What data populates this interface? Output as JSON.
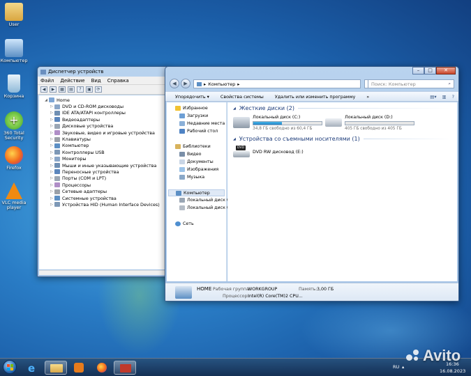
{
  "desktop": {
    "icons": [
      {
        "label": "User"
      },
      {
        "label": "Компьютер"
      },
      {
        "label": "Корзина"
      },
      {
        "label": "360 Total Security"
      },
      {
        "label": "Firefox"
      },
      {
        "label": "VLC media player"
      }
    ]
  },
  "devmgr": {
    "title": "Диспетчер устройств",
    "menu": [
      "Файл",
      "Действие",
      "Вид",
      "Справка"
    ],
    "root": "Home",
    "nodes": [
      "DVD и CD-ROM дисководы",
      "IDE ATA/ATAPI контроллеры",
      "Видеоадаптеры",
      "Дисковые устройства",
      "Звуковые, видео и игровые устройства",
      "Клавиатуры",
      "Компьютер",
      "Контроллеры USB",
      "Мониторы",
      "Мыши и иные указывающие устройства",
      "Переносные устройства",
      "Порты (COM и LPT)",
      "Процессоры",
      "Сетевые адаптеры",
      "Системные устройства",
      "Устройства HID (Human Interface Devices)"
    ]
  },
  "explorer": {
    "address": "Компьютер",
    "address_arrow": "▸",
    "search_placeholder": "Поиск: Компьютер",
    "commands": [
      "Упорядочить ▾",
      "Свойства системы",
      "Удалить или изменить программу",
      "»"
    ],
    "nav": {
      "favorites": "Избранное",
      "fav_items": [
        "Загрузки",
        "Недавние места",
        "Рабочий стол"
      ],
      "libraries": "Библиотеки",
      "lib_items": [
        "Видео",
        "Документы",
        "Изображения",
        "Музыка"
      ],
      "computer": "Компьютер",
      "comp_items": [
        "Локальный диск (C",
        "Локальный диск (D"
      ],
      "network": "Сеть"
    },
    "groups": {
      "hdd": "Жесткие диски (2)",
      "removable": "Устройства со съемными носителями (1)"
    },
    "drives": [
      {
        "name": "Локальный диск (C:)",
        "free": "34,8 ГБ свободно из 60,4 ГБ",
        "used_fraction": 0.42
      },
      {
        "name": "Локальный диск (D:)",
        "free": "405 ГБ свободно из 405 ГБ",
        "used_fraction": 0.0
      }
    ],
    "dvd": {
      "name": "DVD RW дисковод (E:)",
      "badge": "DVD"
    },
    "details": {
      "name": "HOME",
      "workgroup_label": "Рабочая группа:",
      "workgroup": "WORKGROUP",
      "memory_label": "Память:",
      "memory": "3,00 ГБ",
      "cpu_label": "Процессор:",
      "cpu": "Intel(R) Core(TM)2 CPU..."
    }
  },
  "taskbar": {
    "lang": "RU",
    "time": "16:36",
    "date": "16.08.2023"
  },
  "watermark": "Avito",
  "colors": {
    "accent": "#2a7dc6",
    "drive_fill": "#2587c9",
    "group_text": "#1e3d7b"
  }
}
